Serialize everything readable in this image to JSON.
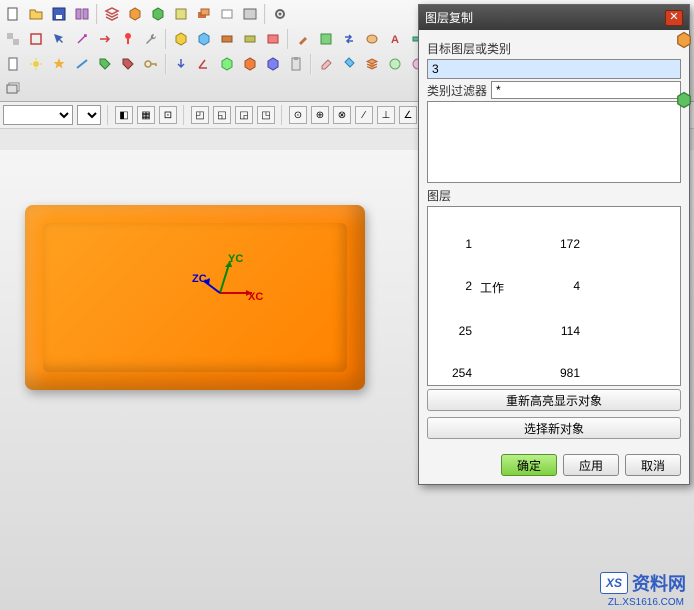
{
  "toolbars": {
    "row1_icons": [
      "new",
      "open",
      "save",
      "book",
      "layer",
      "cube",
      "cube2",
      "box",
      "stack",
      "sheet",
      "panel",
      "settings"
    ],
    "row2_icons": [
      "transparent",
      "clip",
      "select",
      "magic",
      "arrow",
      "pin",
      "wrench",
      "cube-a",
      "cube-b",
      "brick",
      "brick2",
      "pocket",
      "brush",
      "board",
      "swap",
      "palette",
      "text",
      "label",
      "box1",
      "box2",
      "stamp",
      "cut",
      "gem",
      "hex",
      "hex2",
      "s-char",
      "badge"
    ],
    "row3_icons": [
      "doc",
      "sun",
      "star",
      "edge",
      "tag",
      "tag2",
      "key",
      "arrow2",
      "angle",
      "cube3",
      "cube4",
      "cube5",
      "clip2",
      "eraser",
      "bucket",
      "layers",
      "round",
      "round2",
      "color1",
      "color2",
      "color3",
      "cube6",
      "cube7",
      "cube8",
      "reset",
      "pin2",
      "cube9",
      "x-tool",
      "measure",
      "grid",
      "half"
    ]
  },
  "secondary": {
    "dropdown_value": "",
    "small_icons": [
      "a",
      "b",
      "c",
      "d",
      "e",
      "f",
      "g",
      "h",
      "i",
      "j",
      "k",
      "l",
      "m",
      "n",
      "o",
      "p",
      "q",
      "r",
      "s",
      "t",
      "u",
      "v",
      "w",
      "x"
    ]
  },
  "csys": {
    "x": "XC",
    "y": "YC",
    "z": "ZC"
  },
  "dialog": {
    "title": "图层复制",
    "target_label": "目标图层或类别",
    "target_value": "3",
    "filter_label": "类别过滤器",
    "filter_value": "*",
    "layers_label": "图层",
    "layers": [
      {
        "id": "1",
        "tag": "",
        "count": "172"
      },
      {
        "id": "2",
        "tag": "工作",
        "count": "4"
      },
      {
        "id": "25",
        "tag": "",
        "count": "114"
      },
      {
        "id": "254",
        "tag": "",
        "count": "981"
      }
    ],
    "rehighlight": "重新高亮显示对象",
    "select_new": "选择新对象",
    "ok": "确定",
    "apply": "应用",
    "cancel": "取消"
  },
  "watermark": {
    "logo": "XS",
    "text": "资料网",
    "sub": "ZL.XS1616.COM"
  },
  "colors": {
    "accent": "#7fd040",
    "model": "#ff8800",
    "dialog_title": "#3a3a3a"
  }
}
